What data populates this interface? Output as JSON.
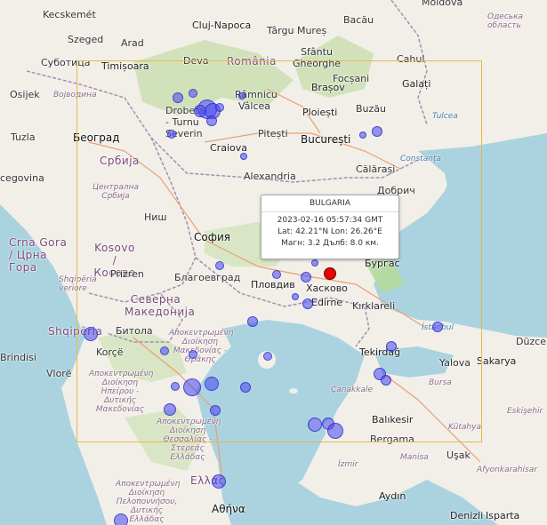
{
  "popup": {
    "title": "BULGARIA",
    "time": "2023-02-16 05:57:34 GMT",
    "coords": "Lat: 42.21°N Lon: 26.26°E",
    "mag": "Магн: 3.2 Дълб: 8.0 км."
  },
  "labels": {
    "kecskemet": "Kecskemét",
    "szeged": "Szeged",
    "subotica": "Суботица",
    "arad": "Arad",
    "timisoara": "Timișoara",
    "cluj": "Cluj-Napoca",
    "targu": "Târgu Mureș",
    "bacau": "Bacău",
    "moldova": "Moldova",
    "odesa": "Одеська область",
    "osijek": "Osijek",
    "vojvodina": "Војводина",
    "deva": "Deva",
    "romania": "România",
    "sfantu": "Sfântu Gheorghe",
    "galati": "Galați",
    "brasov": "Brașov",
    "focsani": "Focșani",
    "cahul": "Cahul",
    "ramnicu": "Râmnicu Vâlcea",
    "ploiesti": "Ploiești",
    "buzau": "Buzău",
    "tulcea": "Tulcea",
    "drobeta": "Drobeta - Turnu Severin",
    "tuzla": "Tuzla",
    "beograd": "Београд",
    "pitesti": "Pitești",
    "bucuresti": "București",
    "craiova": "Craiova",
    "constanta": "Constanța",
    "cegovina": "cegovina",
    "srbija": "Србија",
    "alexandria": "Alexandria",
    "calarasi": "Călărași",
    "dobrich": "Добрич",
    "centralna": "Централна Србија",
    "nish": "Ниш",
    "sofia": "София",
    "crnagora": "Crna Gora / Црна Гора",
    "kosovo": "Kosovo / Косово",
    "blagoevgrad": "Благоевград",
    "plovdiv": "Пловдив",
    "haskovo": "Хасково",
    "burgas": "Бургас",
    "prizren": "Prizren",
    "shqiperia_v": "Shqipëria veriore",
    "severna": "Северна Македонија",
    "edirne": "Edirne",
    "kirklareli": "Kırklareli",
    "istanbul": "İstanbul",
    "duzce": "Düzce",
    "shqiperia": "Shqipëria",
    "bitola": "Битола",
    "apok1": "Αποκεντρωμένη Διοίκηση Μακεδονίας - Θράκης",
    "tekirdag": "Tekirdağ",
    "yalova": "Yalova",
    "sakarya": "Sakarya",
    "brindisi": "Brindisi",
    "korce": "Korçë",
    "vlore": "Vlorë",
    "apok2": "Αποκεντρωμένη Διοίκηση Ηπείρου - Δυτικής Μακεδονίας",
    "canakkale": "Çanakkale",
    "bursa": "Bursa",
    "balikesir": "Balıkesir",
    "eskisehir": "Eskişehir",
    "apok3": "Αποκεντρωμένη Διοίκηση Θεσσαλίας - Στερεάς Ελλάδας",
    "bergama": "Bergama",
    "kutahya": "Kütahya",
    "usak": "Uşak",
    "izmir": "İzmir",
    "manisa": "Manisa",
    "afyon": "Afyonkarahisar",
    "ellas": "Ελλάς",
    "apok4": "Αποκεντρωμένη Διοίκηση Πελοποννήσου, Δυτικής Ελλάδας",
    "athina": "Αθήνα",
    "aydin": "Aydın",
    "denizli": "Denizli",
    "isparta": "Isparta"
  },
  "colors": {
    "sea": "#aad3df",
    "land": "#f2efe9",
    "forest": "#c8dfae",
    "bbox": "#e8b84a",
    "quake": "#4646f0",
    "selected": "#e00000"
  }
}
